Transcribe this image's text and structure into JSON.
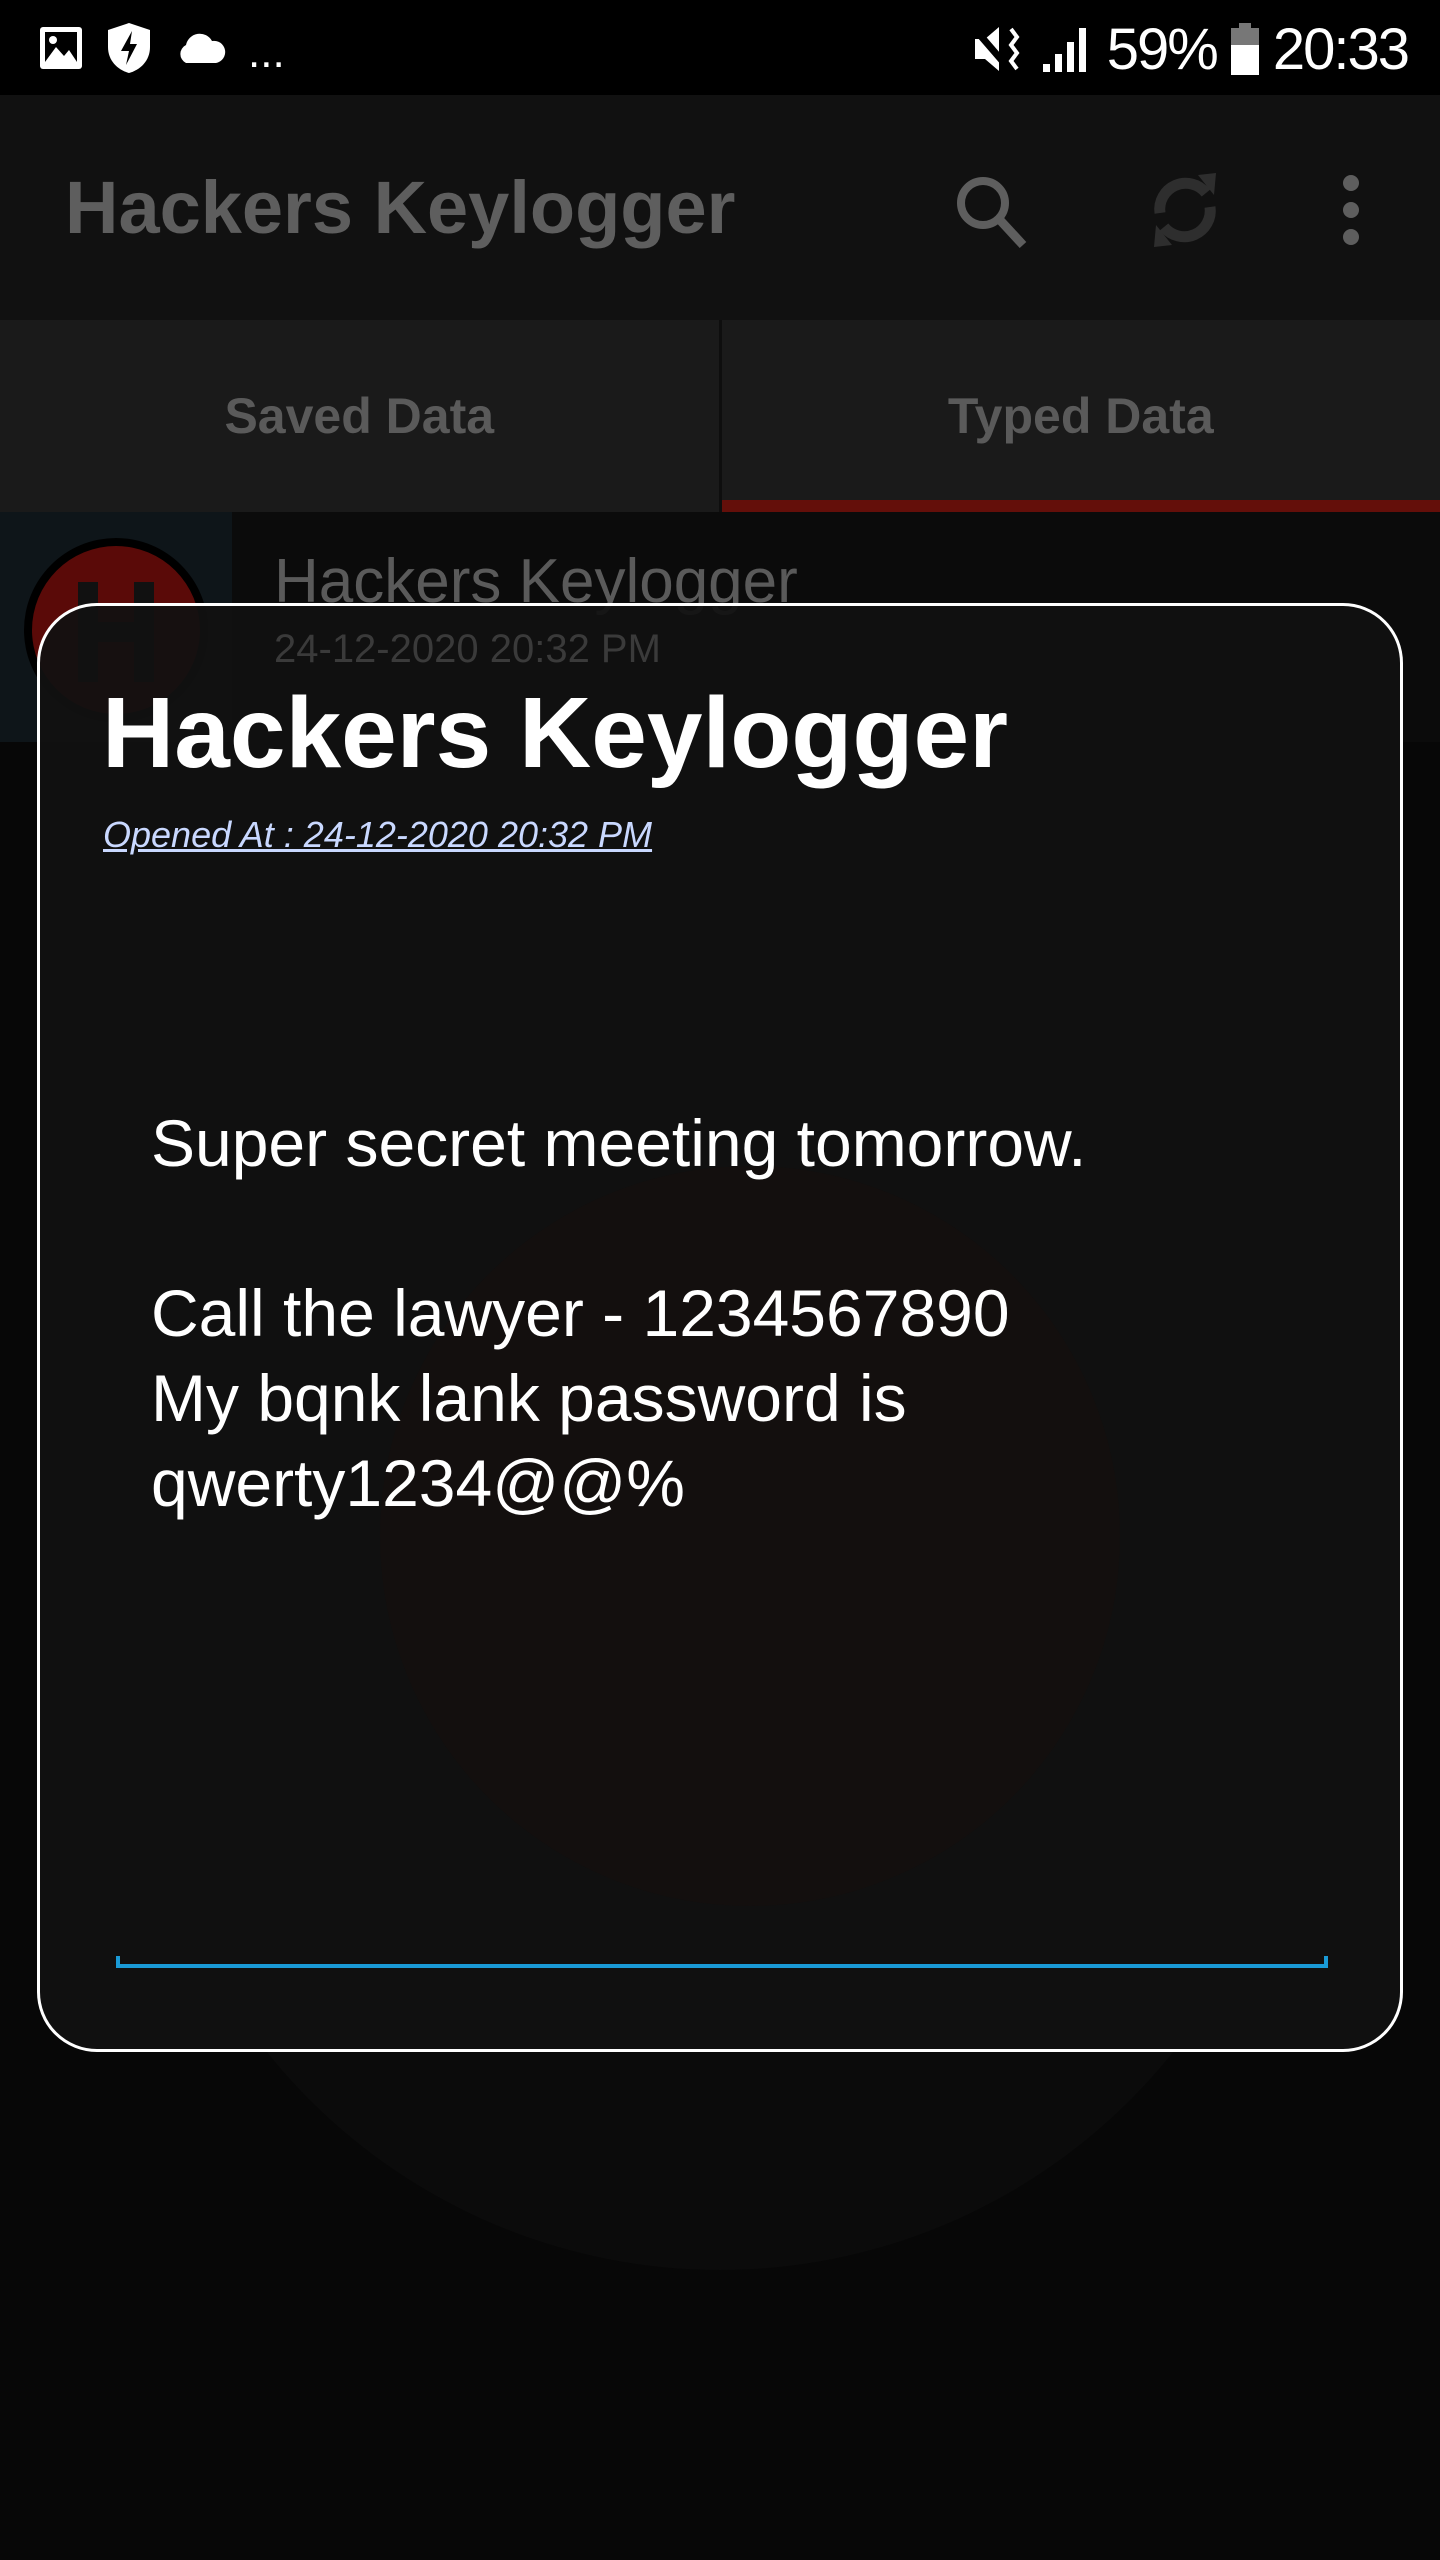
{
  "status_bar": {
    "icons": [
      "gallery-icon",
      "shield-bolt-icon",
      "cloud-icon"
    ],
    "more": "...",
    "battery": "59%",
    "time": "20:33",
    "right_icons": [
      "vibrate-mute-icon",
      "signal-icon",
      "battery-icon"
    ]
  },
  "app_bar": {
    "title": "Hackers Keylogger",
    "actions": [
      "search-icon",
      "refresh-icon",
      "more-vert-icon"
    ]
  },
  "tabs": [
    {
      "label": "Saved Data",
      "active": false
    },
    {
      "label": "Typed Data",
      "active": true
    }
  ],
  "list": {
    "items": [
      {
        "title": "Hackers Keylogger",
        "date": "24-12-2020 20:32 PM"
      }
    ]
  },
  "dialog": {
    "title": "Hackers Keylogger",
    "opened_at": "Opened At : 24-12-2020 20:32 PM",
    "text": "Super secret meeting tomorrow.\n\nCall the lawyer - 1234567890\nMy bqnk lank password is\nqwerty1234@@%"
  },
  "colors": {
    "accent_tab": "#640f0a",
    "input_line": "#1a9ad6",
    "link": "#c9d8ff"
  }
}
